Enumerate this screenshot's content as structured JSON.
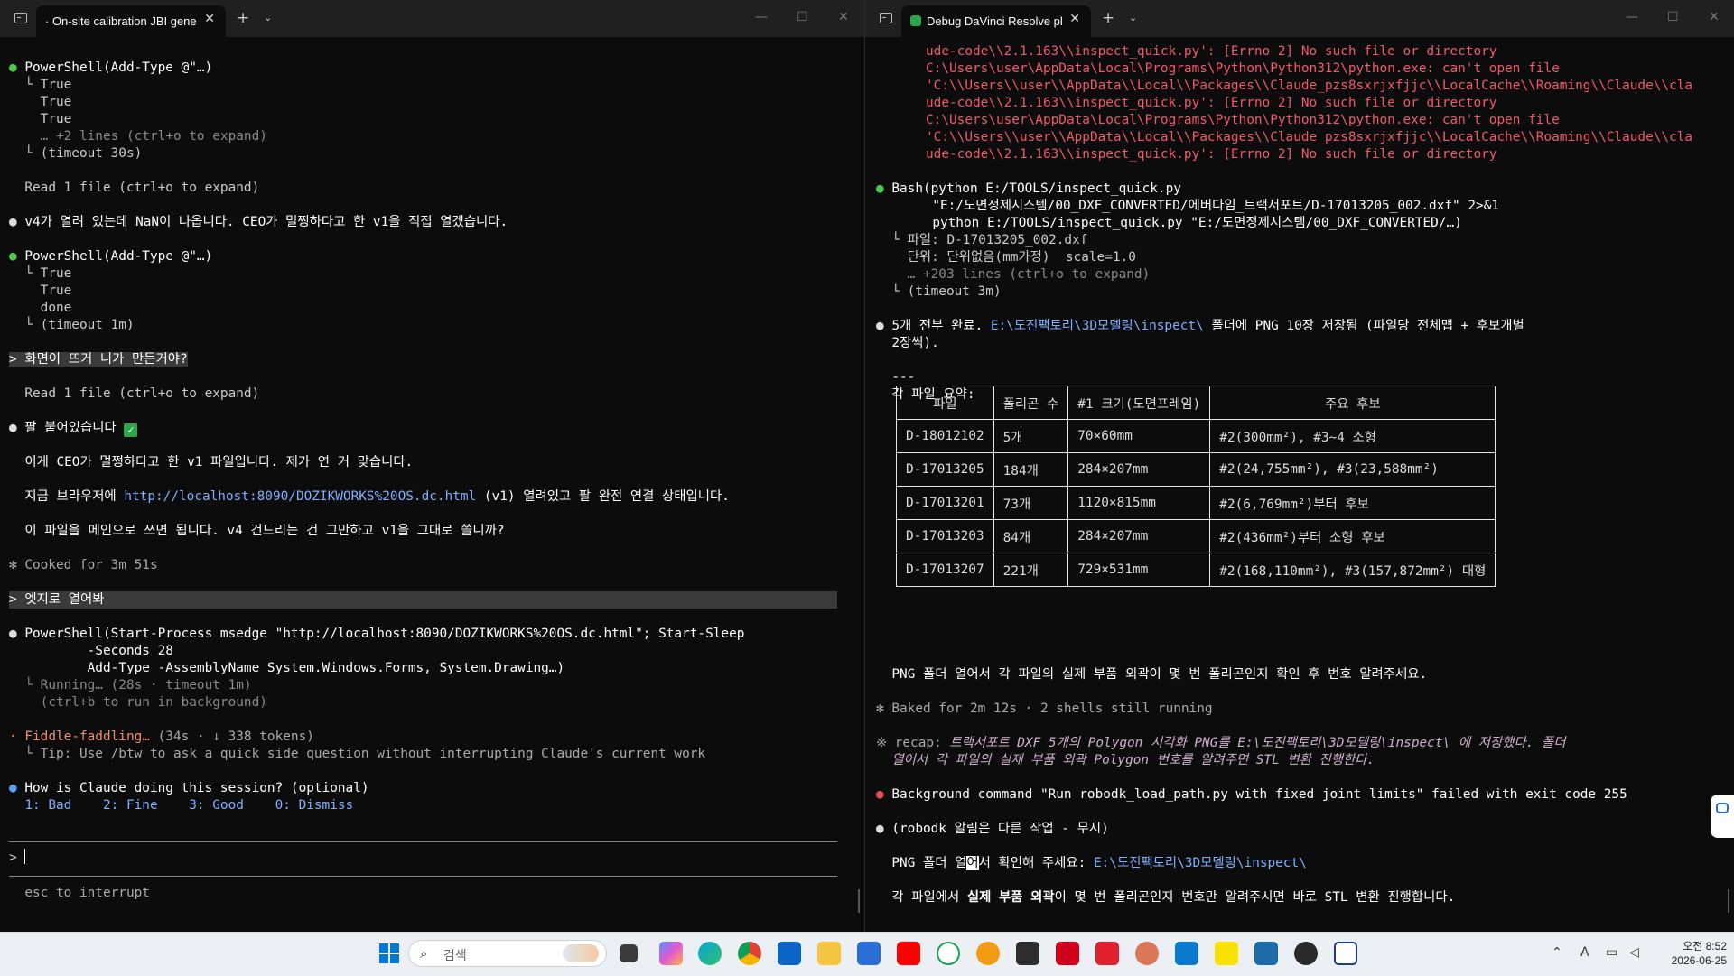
{
  "left": {
    "tab_title": "· On-site calibration JBI gene",
    "lines": [
      "PowerShell(Add-Type @\"…)",
      "  └ True",
      "    True",
      "    True",
      "    … +2 lines (ctrl+o to expand)",
      "  └ (timeout 30s)",
      "Read 1 file (ctrl+o to expand)",
      "v4가 열려 있는데 NaN이 나옵니다. CEO가 멀쩡하다고 한 v1을 직접 열겠습니다.",
      "PowerShell(Add-Type @\"…)",
      "  └ True",
      "    True",
      "    done",
      "  └ (timeout 1m)",
      "> 화면이 뜨거 니가 만든거야?",
      "Read 1 file (ctrl+o to expand)",
      "팔 붙어있습니다",
      "이게 CEO가 멀쩡하다고 한 v1 파일입니다. 제가 연 거 맞습니다.",
      "지금 브라우저에 ",
      "http://localhost:8090/DOZIKWORKS%20OS.dc.html",
      " (v1) 열려있고 팔 완전 연결 상태입니다.",
      "이 파일을 메인으로 쓰면 됩니다. v4 건드리는 건 그만하고 v1을 그대로 쓸니까?",
      "✻ Cooked for 3m 51s",
      "> 엣지로 열어봐",
      "PowerShell(Start-Process msedge \"http://localhost:8090/DOZIKWORKS%20OS.dc.html\"; Start-Sleep",
      "          -Seconds 28",
      "          Add-Type -AssemblyName System.Windows.Forms, System.Drawing…)",
      "  └ Running… (28s · timeout 1m)",
      "    (ctrl+b to run in background)",
      "· Fiddle-faddling… ",
      "(34s · ↓ 338 tokens)",
      "  └ Tip: Use /btw to ask a quick side question without interrupting Claude's current work",
      "How is Claude doing this session? (optional)",
      "  1: Bad    2: Fine    3: Good    0: Dismiss",
      "> ",
      "  esc to interrupt"
    ]
  },
  "right": {
    "tab_title": "Debug DaVinci Resolve pl",
    "errors": [
      "ude-code\\\\2.1.163\\\\inspect_quick.py': [Errno 2] No such file or directory",
      "C:\\Users\\user\\AppData\\Local\\Programs\\Python\\Python312\\python.exe: can't open file",
      "'C:\\\\Users\\\\user\\\\AppData\\\\Local\\\\Packages\\\\Claude_pzs8sxrjxfjjc\\\\LocalCache\\\\Roaming\\\\Claude\\\\cla",
      "ude-code\\\\2.1.163\\\\inspect_quick.py': [Errno 2] No such file or directory",
      "C:\\Users\\user\\AppData\\Local\\Programs\\Python\\Python312\\python.exe: can't open file",
      "'C:\\\\Users\\\\user\\\\AppData\\\\Local\\\\Packages\\\\Claude_pzs8sxrjxfjjc\\\\LocalCache\\\\Roaming\\\\Claude\\\\cla",
      "ude-code\\\\2.1.163\\\\inspect_quick.py': [Errno 2] No such file or directory"
    ],
    "bash": [
      "Bash(python E:/TOOLS/inspect_quick.py",
      "     \"E:/도면정제시스템/00_DXF_CONVERTED/에버다임_트랙서포트/D-17013205_002.dxf\" 2>&1",
      "     python E:/TOOLS/inspect_quick.py \"E:/도면정제시스템/00_DXF_CONVERTED/…)",
      "  └ 파일: D-17013205_002.dxf",
      "    단위: 단위없음(mm가정)  scale=1.0",
      "    … +203 lines (ctrl+o to expand)",
      "  └ (timeout 3m)"
    ],
    "done_a": "5개 전부 완료. ",
    "done_path": "E:\\도진팩토리\\3D모델링\\inspect\\",
    "done_b": " 폴더에 PNG 10장 저장됨 (파일당 전체맵 + 후보개별",
    "done_c": "2장씩).",
    "rule": "---",
    "summary_title": "각 파일 요약:",
    "table_headers": [
      "파일",
      "폴리곤 수",
      "#1 크기(도면프레임)",
      "주요 후보"
    ],
    "table_rows": [
      [
        "D-18012102",
        "5개",
        "70×60mm",
        "#2(300mm²), #3~4 소형"
      ],
      [
        "D-17013205",
        "184개",
        "284×207mm",
        "#2(24,755mm²), #3(23,588mm²)"
      ],
      [
        "D-17013201",
        "73개",
        "1120×815mm",
        "#2(6,769mm²)부터 후보"
      ],
      [
        "D-17013203",
        "84개",
        "284×207mm",
        "#2(436mm²)부터 소형 후보"
      ],
      [
        "D-17013207",
        "221개",
        "729×531mm",
        "#2(168,110mm²), #3(157,872mm²) 대형"
      ]
    ],
    "png_request": "PNG 폴더 열어서 각 파일의 실제 부품 외곽이 몇 번 폴리곤인지 확인 후 번호 알려주세요.",
    "baked": "✻ Baked for 2m 12s · 2 shells still running",
    "recap_label": "※ recap: ",
    "recap_1": "트랙서포트 DXF 5개의 Polygon 시각화 PNG를 E:\\도진팩토리\\3D모델링\\inspect\\ 에 저장했다. 폴더",
    "recap_2": "  열어서 각 파일의 실제 부품 외곽 Polygon 번호를 알려주면 STL 변환 진행한다.",
    "bg_failed": "Background command \"Run robodk_load_path.py with fixed joint limits\" failed with exit code 255",
    "robodk": "(robodk 알림은 다른 작업 - 무시)",
    "confirm_a": "PNG 폴더 열",
    "confirm_cursor": "어",
    "confirm_b": "서 확인해 주세요: ",
    "confirm_path": "E:\\도진팩토리\\3D모델링\\inspect\\",
    "final_a": "각 파일에서 ",
    "final_bold": "실제 부품 외곽",
    "final_b": "이 몇 번 폴리곤인지 번호만 알려주시면 바로 STL 변환 진행합니다."
  },
  "taskbar": {
    "search_placeholder": "검색",
    "time": "오전 8:52",
    "date": "2026-06-25",
    "lang": "A",
    "icons": [
      "start-icon",
      "search-icon",
      "task-view-icon",
      "copilot-icon",
      "edge-icon",
      "chrome-icon",
      "outlook-icon",
      "file-explorer-icon",
      "store-icon",
      "youtube-icon",
      "chatgpt-icon",
      "search-tool-icon",
      "terminal-icon",
      "acrobat-icon",
      "pdf-icon",
      "claude-icon",
      "vscode-icon",
      "kakaotalk-icon",
      "app-icon",
      "davinci-icon",
      "teams-icon"
    ]
  }
}
